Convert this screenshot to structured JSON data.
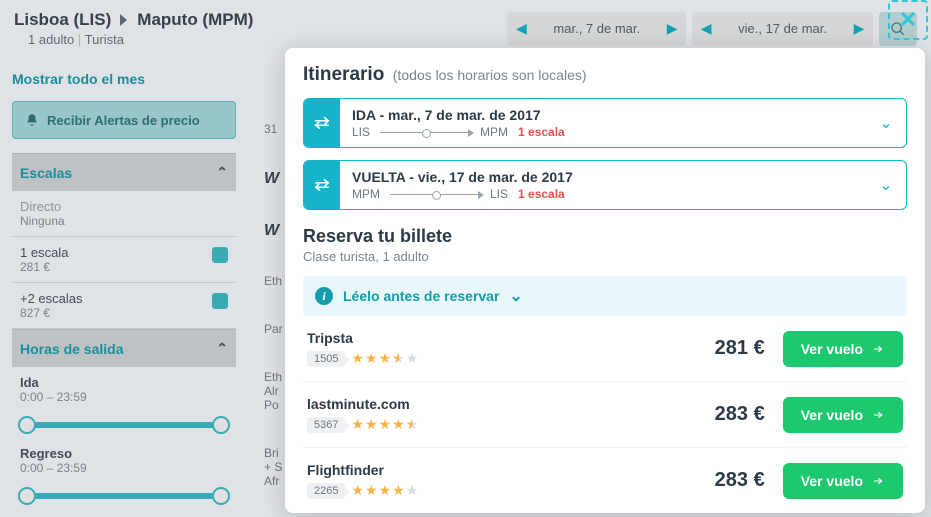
{
  "route": {
    "from": "Lisboa (LIS)",
    "to": "Maputo (MPM)",
    "sub1": "1 adulto",
    "sub2": "Turista"
  },
  "dates": {
    "out": "mar., 7 de mar.",
    "ret": "vie., 17 de mar."
  },
  "sidebar": {
    "month_link": "Mostrar todo el mes",
    "alert_label": "Recibir Alertas de precio",
    "stops_header": "Escalas",
    "direct_label": "Directo",
    "direct_sub": "Ninguna",
    "one_label": "1 escala",
    "one_price": "281 €",
    "two_label": "+2 escalas",
    "two_price": "827 €",
    "times_header": "Horas de salida",
    "out_label": "Ida",
    "out_range": "0:00 – 23:59",
    "ret_label": "Regreso",
    "ret_range": "0:00 – 23:59"
  },
  "mid": {
    "a": "31",
    "b": "W",
    "c": "W",
    "d": "Eth",
    "e": "Par",
    "f": "Eth\nAlr\nPo",
    "g": "Bri\n+ S\nAfr"
  },
  "modal": {
    "title": "Itinerario",
    "title_sub": "(todos los horarios son locales)",
    "leg_out_title": "IDA - mar., 7 de mar. de 2017",
    "leg_out_from": "LIS",
    "leg_out_to": "MPM",
    "leg_out_stops": "1 escala",
    "leg_ret_title": "VUELTA - vie., 17 de mar. de 2017",
    "leg_ret_from": "MPM",
    "leg_ret_to": "LIS",
    "leg_ret_stops": "1 escala",
    "book_title": "Reserva tu billete",
    "book_sub": "Clase turista, 1 adulto",
    "read_before": "Léelo antes de reservar",
    "go_label": "Ver vuelo",
    "offers": [
      {
        "name": "Tripsta",
        "count": "1505",
        "rating": 3.5,
        "price": "281 €"
      },
      {
        "name": "lastminute.com",
        "count": "5367",
        "rating": 4.5,
        "price": "283 €"
      },
      {
        "name": "Flightfinder",
        "count": "2265",
        "rating": 4.0,
        "price": "283 €"
      }
    ]
  }
}
